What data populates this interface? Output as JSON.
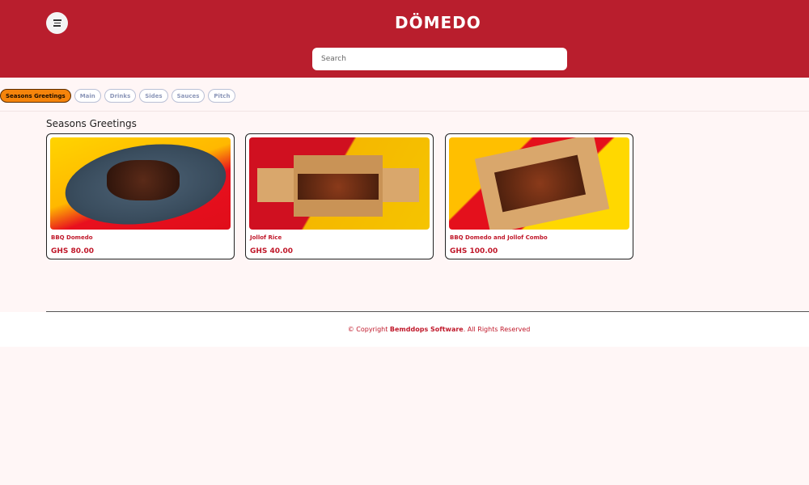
{
  "header": {
    "logo": "DÖMEDO",
    "search_placeholder": "Search",
    "menu_icon": "menu-icon"
  },
  "categories": [
    {
      "label": "Seasons Greetings",
      "active": true
    },
    {
      "label": "Main"
    },
    {
      "label": "Drinks"
    },
    {
      "label": "Sides"
    },
    {
      "label": "Sauces"
    },
    {
      "label": "Pitch"
    }
  ],
  "section": {
    "title": "Seasons Greetings"
  },
  "products": [
    {
      "name": "BBQ Domedo",
      "price": "GHS 80.00"
    },
    {
      "name": "Jollof Rice",
      "price": "GHS 40.00"
    },
    {
      "name": "BBQ Domedo and Jollof Combo",
      "price": "GHS 100.00"
    }
  ],
  "footer": {
    "prefix": "© Copyright",
    "company": "Bemddops Software",
    "suffix": ". All Rights Reserved"
  },
  "colors": {
    "brand": "#b91e2d",
    "accent": "#f5840b"
  }
}
